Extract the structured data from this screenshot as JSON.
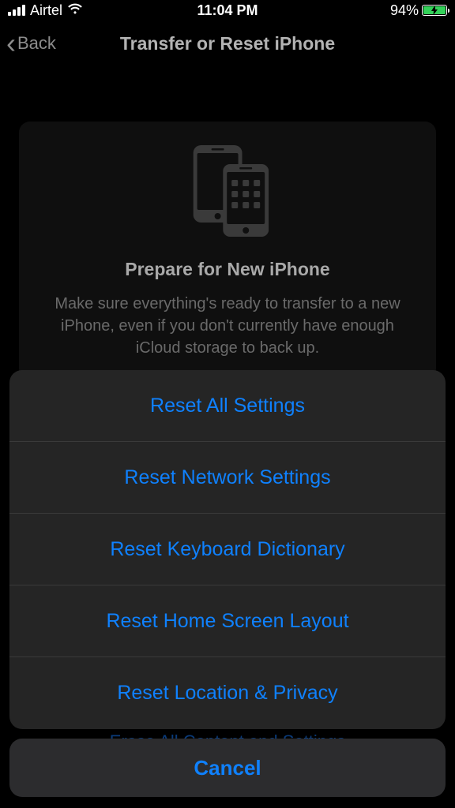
{
  "statusBar": {
    "carrier": "Airtel",
    "time": "11:04 PM",
    "batteryPercent": "94%"
  },
  "nav": {
    "backLabel": "Back",
    "title": "Transfer or Reset iPhone"
  },
  "card": {
    "title": "Prepare for New iPhone",
    "description": "Make sure everything's ready to transfer to a new iPhone, even if you don't currently have enough iCloud storage to back up."
  },
  "hiddenRow": "Erase All Content and Settings",
  "actionSheet": {
    "options": [
      "Reset All Settings",
      "Reset Network Settings",
      "Reset Keyboard Dictionary",
      "Reset Home Screen Layout",
      "Reset Location & Privacy"
    ],
    "cancel": "Cancel"
  }
}
